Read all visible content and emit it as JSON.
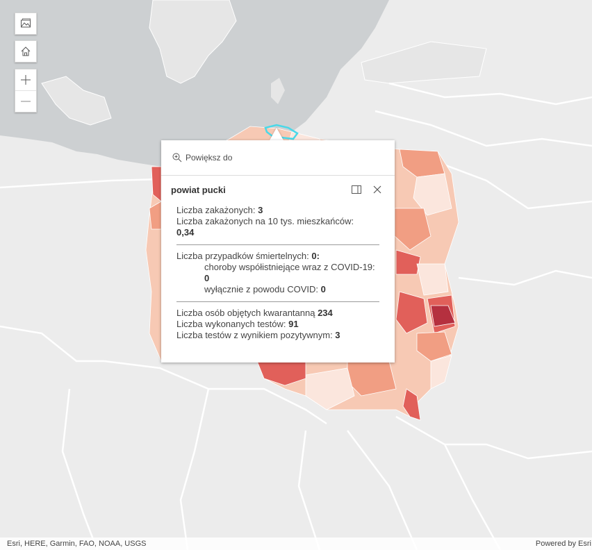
{
  "map": {
    "controls": {
      "basemap_icon": "basemap-gallery-icon",
      "home_icon": "home-icon",
      "zoom_in_icon": "plus-icon",
      "zoom_out_icon": "minus-icon"
    },
    "colors": {
      "water": "#cdd0d2",
      "land": "#ececec",
      "border": "#ffffff",
      "selected_outline": "#4ad8e8",
      "class_1": "#fbe6dd",
      "class_2": "#f7c9b4",
      "class_3": "#f19e83",
      "class_4": "#e1605a",
      "class_5": "#b5303f"
    }
  },
  "popup": {
    "zoom_to_label": "Powiększ do",
    "zoom_icon": "zoom-in-magnifier-icon",
    "title": "powiat pucki",
    "dock_icon": "dock-icon",
    "close_icon": "close-icon",
    "fields": {
      "infected_label": "Liczba zakażonych: ",
      "infected_value": "3",
      "per10k_label": "Liczba zakażonych na 10 tys. mieszkańców:",
      "per10k_value": "0,34",
      "deaths_label": "Liczba przypadków śmiertelnych: ",
      "deaths_value": "0:",
      "comorbid_label": "choroby współistniejące wraz z COVID-19: ",
      "comorbid_value": "0",
      "covid_only_label": "wyłącznie z powodu COVID: ",
      "covid_only_value": "0",
      "quarantine_label": "Liczba osób objętych kwarantanną ",
      "quarantine_value": "234",
      "tests_label": "Liczba wykonanych testów: ",
      "tests_value": "91",
      "positive_label": "Liczba testów z wynikiem pozytywnym: ",
      "positive_value": "3"
    }
  },
  "attribution": {
    "sources": "Esri, HERE, Garmin, FAO, NOAA, USGS",
    "powered_by": "Powered by Esri"
  }
}
